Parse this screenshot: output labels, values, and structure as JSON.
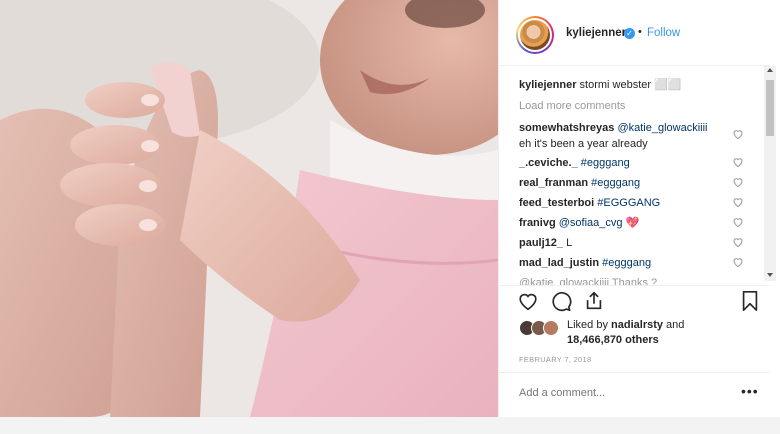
{
  "header": {
    "username": "kyliejenner",
    "verified_icon": "verified-badge-icon",
    "separator": "•",
    "follow_label": "Follow"
  },
  "caption": {
    "username": "kyliejenner",
    "text": "stormi webster ⬜⬜"
  },
  "load_more_label": "Load more comments",
  "comments": [
    {
      "user": "somewhatshreyas",
      "mention": "@katie_glowackiiii",
      "text": "eh it's been a year already"
    },
    {
      "user": "_.ceviche._",
      "mention": "#egggang",
      "text": ""
    },
    {
      "user": "real_franman",
      "mention": "#egggang",
      "text": ""
    },
    {
      "user": "feed_testerboi",
      "mention": "#EGGGANG",
      "text": ""
    },
    {
      "user": "franivg",
      "mention": "@sofiaa_cvg",
      "text": "💖"
    },
    {
      "user": "paulj12_",
      "mention": "",
      "text": "L"
    },
    {
      "user": "mad_lad_justin",
      "mention": "#egggang",
      "text": ""
    },
    {
      "user": "",
      "mention": "",
      "text": "@katie_glowackiiii Thanks ?"
    }
  ],
  "likes": {
    "prefix": "Liked by ",
    "user": "nadialrsty",
    "suffix": " and",
    "count": "18,466,870 others"
  },
  "date": "FEBRUARY 7, 2018",
  "add_comment_placeholder": "Add a comment...",
  "more_label": "•••",
  "colors": {
    "link": "#3897f0",
    "mention": "#003569",
    "muted": "#999999",
    "border": "#efefef"
  }
}
